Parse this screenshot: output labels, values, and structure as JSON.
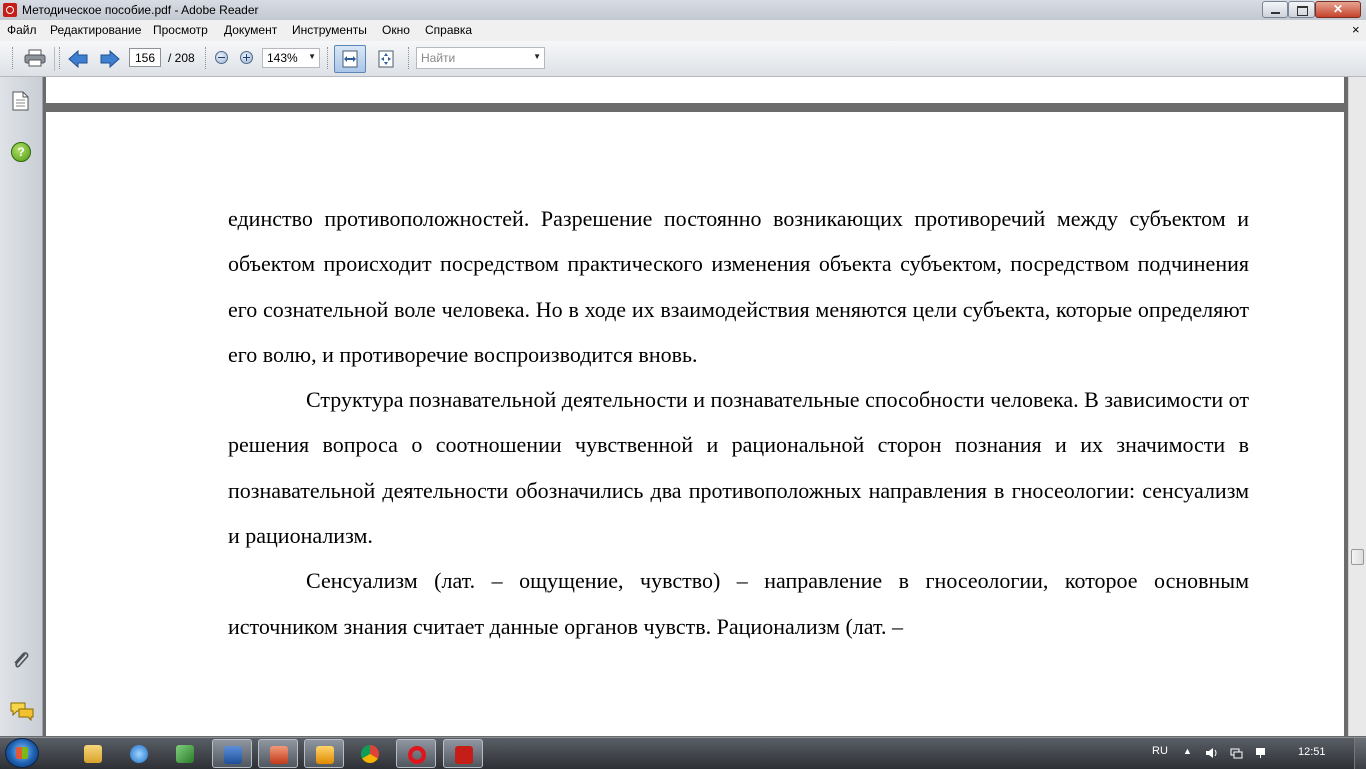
{
  "window": {
    "title": "Методическое пособие.pdf - Adobe Reader",
    "controls": {
      "minimize": "minimize",
      "maximize": "maximize",
      "close": "close"
    }
  },
  "menu": {
    "items": [
      "Файл",
      "Редактирование",
      "Просмотр",
      "Документ",
      "Инструменты",
      "Окно",
      "Справка"
    ],
    "close_glyph": "×"
  },
  "toolbar": {
    "page_current": "156",
    "page_total": "/ 208",
    "zoom": "143%",
    "find_placeholder": "Найти",
    "icons": [
      "printer-icon",
      "previous-page-icon",
      "next-page-icon",
      "zoom-out-icon",
      "zoom-in-icon",
      "fit-width-icon",
      "fit-page-icon"
    ]
  },
  "navpane": {
    "icons": [
      "pages-icon",
      "help-icon",
      "attachments-icon",
      "comments-icon"
    ],
    "help_glyph": "?"
  },
  "document": {
    "paragraphs": [
      "единство противоположностей. Разрешение постоянно возникающих противоречий между субъектом и объектом происходит посредством практического изменения объекта субъектом, посредством подчинения его сознательной воле человека. Но в ходе их взаимодействия меняются цели субъекта, которые определяют его волю, и противоречие воспроизводится вновь.",
      "Структура познавательной деятельности и познавательные способности человека. В зависимости от решения вопроса о соотношении чувственной и рациональной сторон познания и их значимости в познавательной деятельности обозначились два противоположных направления в гносеологии: сенсуализм и рационализм.",
      "Сенсуализм (лат. – ощущение, чувство) – направление в гносеологии, которое основным источником знания считает данные органов чувств. Рационализм (лат. –"
    ]
  },
  "taskbar": {
    "apps": [
      "explorer",
      "internet-explorer",
      "network",
      "word",
      "scanner",
      "media-player",
      "chrome",
      "opera",
      "adobe-reader"
    ],
    "active_app": "adobe-reader",
    "language": "RU",
    "time": "12:51"
  },
  "colors": {
    "doc_background": "#6b6b6b",
    "page": "#ffffff",
    "reader_red": "#c41e16"
  }
}
